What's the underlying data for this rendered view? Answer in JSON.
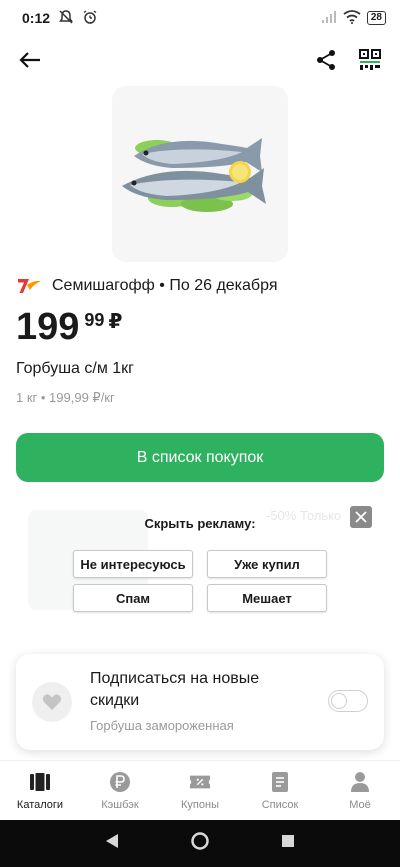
{
  "status_bar": {
    "time": "0:12",
    "battery": "28"
  },
  "product": {
    "store_name": "Семишагофф",
    "separator": "•",
    "valid_until": "По 26 декабря",
    "price_rub": "199",
    "price_kop": "99",
    "currency": "₽",
    "name": "Горбуша с/м 1кг",
    "unit_info": "1 кг • 199,99 ₽/кг"
  },
  "actions": {
    "add_to_list": "В список покупок"
  },
  "ad_hide": {
    "title": "Скрыть рекламу:",
    "ghost_text": "-50% Только",
    "options": [
      "Не интересуюсь",
      "Уже купил",
      "Спам",
      "Мешает"
    ]
  },
  "subscribe": {
    "title": "Подписаться на новые скидки",
    "caption": "Горбуша замороженная",
    "enabled": false
  },
  "bottom_nav": {
    "items": [
      {
        "label": "Каталоги",
        "icon": "catalog-icon",
        "active": true
      },
      {
        "label": "Кэшбэк",
        "icon": "ruble-icon",
        "active": false
      },
      {
        "label": "Купоны",
        "icon": "coupon-icon",
        "active": false
      },
      {
        "label": "Список",
        "icon": "list-icon",
        "active": false
      },
      {
        "label": "Моё",
        "icon": "profile-icon",
        "active": false
      }
    ]
  },
  "colors": {
    "accent": "#2fb25f",
    "text": "#1a1a1a",
    "muted": "#9a9a9a",
    "store_logo": "#e53935"
  }
}
